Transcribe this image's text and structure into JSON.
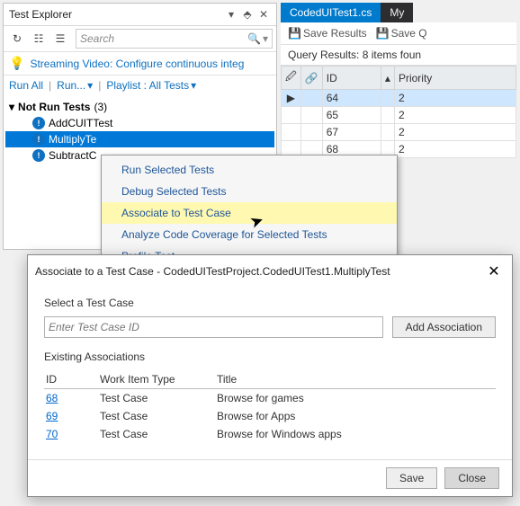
{
  "testExplorer": {
    "title": "Test Explorer",
    "searchPlaceholder": "Search",
    "infoBar": "Streaming Video: Configure continuous integ",
    "runBar": {
      "runAll": "Run All",
      "run": "Run...",
      "playlist": "Playlist : All Tests"
    },
    "group": {
      "label": "Not Run Tests",
      "count": "(3)"
    },
    "items": [
      "AddCUITTest",
      "MultiplyTe",
      "SubtractC"
    ]
  },
  "rightPanel": {
    "tabs": [
      "CodedUITest1.cs",
      "My"
    ],
    "toolbar": {
      "saveResults": "Save Results",
      "saveQ": "Save Q"
    },
    "queryLine": "Query Results: 8 items foun",
    "gridHeaders": {
      "id": "ID",
      "priority": "Priority"
    },
    "rows": [
      {
        "id": "64",
        "priority": "2",
        "selected": true
      },
      {
        "id": "65",
        "priority": "2",
        "selected": false
      },
      {
        "id": "67",
        "priority": "2",
        "selected": false
      },
      {
        "id": "68",
        "priority": "2",
        "selected": false
      }
    ]
  },
  "contextMenu": [
    {
      "label": "Run Selected Tests",
      "highlight": false
    },
    {
      "label": "Debug Selected Tests",
      "highlight": false
    },
    {
      "label": "Associate to Test Case",
      "highlight": true
    },
    {
      "label": "Analyze Code Coverage for Selected Tests",
      "highlight": false
    },
    {
      "label": "Profile Test",
      "highlight": false
    }
  ],
  "dialog": {
    "title": "Associate to a Test Case - CodedUITestProject.CodedUITest1.MultiplyTest",
    "selectLabel": "Select a Test Case",
    "inputPlaceholder": "Enter Test Case ID",
    "addBtn": "Add Association",
    "existingLabel": "Existing Associations",
    "headers": {
      "id": "ID",
      "type": "Work Item Type",
      "title": "Title"
    },
    "rows": [
      {
        "id": "68",
        "type": "Test Case",
        "title": "Browse for games"
      },
      {
        "id": "69",
        "type": "Test Case",
        "title": "Browse for Apps"
      },
      {
        "id": "70",
        "type": "Test Case",
        "title": "Browse for Windows apps"
      }
    ],
    "saveBtn": "Save",
    "closeBtn": "Close"
  }
}
